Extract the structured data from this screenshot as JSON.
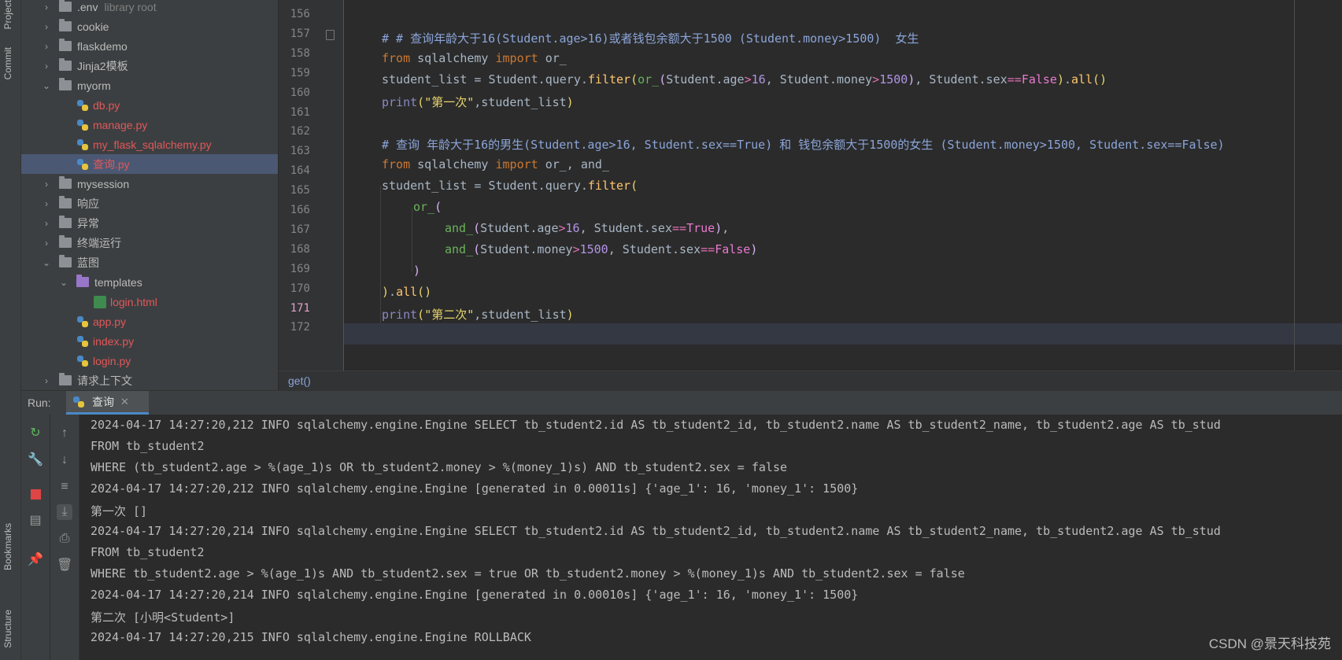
{
  "left_strip": {
    "tabs": [
      "Project",
      "Commit",
      "Bookmarks",
      "Structure"
    ]
  },
  "project_tree": {
    "rows": [
      {
        "label": ".env",
        "suffix": "library root",
        "kind": "folder",
        "expanded": false,
        "depth": 0
      },
      {
        "label": "cookie",
        "kind": "folder",
        "expanded": false,
        "depth": 0
      },
      {
        "label": "flaskdemo",
        "kind": "folder",
        "expanded": false,
        "depth": 0
      },
      {
        "label": "Jinja2模板",
        "kind": "folder",
        "expanded": false,
        "depth": 0
      },
      {
        "label": "myorm",
        "kind": "folder",
        "expanded": true,
        "depth": 0
      },
      {
        "label": "db.py",
        "kind": "py",
        "depth": 1
      },
      {
        "label": "manage.py",
        "kind": "py",
        "depth": 1
      },
      {
        "label": "my_flask_sqlalchemy.py",
        "kind": "py",
        "depth": 1
      },
      {
        "label": "查询.py",
        "kind": "py",
        "depth": 1,
        "selected": true
      },
      {
        "label": "mysession",
        "kind": "folder",
        "expanded": false,
        "depth": 0
      },
      {
        "label": "响应",
        "kind": "folder",
        "expanded": false,
        "depth": 0
      },
      {
        "label": "异常",
        "kind": "folder",
        "expanded": false,
        "depth": 0
      },
      {
        "label": "终端运行",
        "kind": "folder",
        "expanded": false,
        "depth": 0
      },
      {
        "label": "蓝图",
        "kind": "folder",
        "expanded": true,
        "depth": 0
      },
      {
        "label": "templates",
        "kind": "folder-purple",
        "expanded": true,
        "depth": 1
      },
      {
        "label": "login.html",
        "kind": "html",
        "depth": 2
      },
      {
        "label": "app.py",
        "kind": "py",
        "depth": 1
      },
      {
        "label": "index.py",
        "kind": "py",
        "depth": 1
      },
      {
        "label": "login.py",
        "kind": "py",
        "depth": 1
      },
      {
        "label": "请求上下文",
        "kind": "folder",
        "expanded": false,
        "depth": 0
      }
    ]
  },
  "editor": {
    "line_numbers": [
      "156",
      "157",
      "158",
      "159",
      "160",
      "161",
      "162",
      "163",
      "164",
      "165",
      "166",
      "167",
      "168",
      "169",
      "170",
      "171",
      "172"
    ],
    "current_line": "171",
    "breadcrumb": "get()"
  },
  "run_panel": {
    "label": "Run:",
    "tab_label": "查询",
    "console_lines": [
      "2024-04-17 14:27:20,212 INFO sqlalchemy.engine.Engine SELECT tb_student2.id AS tb_student2_id, tb_student2.name AS tb_student2_name, tb_student2.age AS tb_stud",
      "FROM tb_student2",
      "WHERE (tb_student2.age > %(age_1)s OR tb_student2.money > %(money_1)s) AND tb_student2.sex = false",
      "2024-04-17 14:27:20,212 INFO sqlalchemy.engine.Engine [generated in 0.00011s] {'age_1': 16, 'money_1': 1500}",
      "第一次 []",
      "2024-04-17 14:27:20,214 INFO sqlalchemy.engine.Engine SELECT tb_student2.id AS tb_student2_id, tb_student2.name AS tb_student2_name, tb_student2.age AS tb_stud",
      "FROM tb_student2",
      "WHERE tb_student2.age > %(age_1)s AND tb_student2.sex = true OR tb_student2.money > %(money_1)s AND tb_student2.sex = false",
      "2024-04-17 14:27:20,214 INFO sqlalchemy.engine.Engine [generated in 0.00010s] {'age_1': 16, 'money_1': 1500}",
      "第二次 [小明<Student>]",
      "2024-04-17 14:27:20,215 INFO sqlalchemy.engine.Engine ROLLBACK"
    ]
  },
  "watermark": "CSDN @景天科技苑",
  "colors": {
    "keyword": "#cc7832",
    "comment": "#8ba5d9",
    "selection": "#4b5873",
    "accent": "#4a88c7"
  }
}
